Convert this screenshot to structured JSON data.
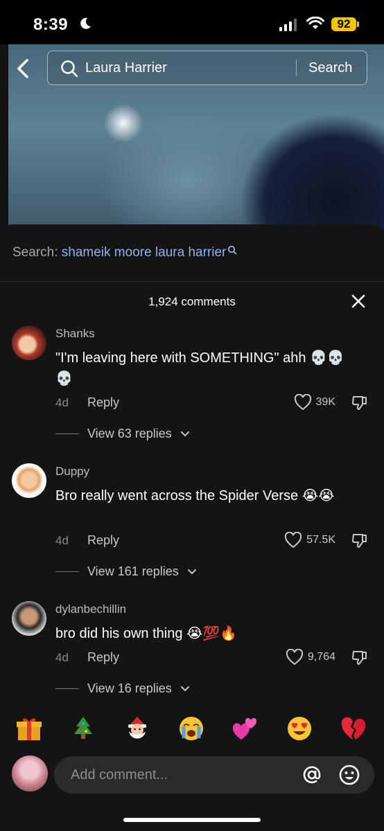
{
  "status_bar": {
    "time": "8:39",
    "battery": "92",
    "battery_color": "#f5c400"
  },
  "search_bar": {
    "query": "Laura Harrier",
    "button_label": "Search"
  },
  "search_suggestion": {
    "label": "Search:",
    "query": "shameik moore laura harrier"
  },
  "comments_panel": {
    "count_label": "1,924 comments"
  },
  "comments": [
    {
      "username": "Shanks",
      "text": "\"I'm leaving here with SOMETHING\" ahh 💀💀💀",
      "age": "4d",
      "reply_label": "Reply",
      "likes": "39K",
      "view_replies": "View 63 replies"
    },
    {
      "username": "Duppy",
      "text": "Bro really went across the Spider Verse 😭😭",
      "age": "4d",
      "reply_label": "Reply",
      "likes": "57.5K",
      "view_replies": "View 161 replies"
    },
    {
      "username": "dylanbechillin",
      "text": "bro did his own thing 😭💯🔥",
      "age": "4d",
      "reply_label": "Reply",
      "likes": "9,764",
      "view_replies": "View 16 replies"
    }
  ],
  "quick_emojis": [
    "🎁",
    "🎄",
    "🎅",
    "😭",
    "💕",
    "😍",
    "💔"
  ],
  "comment_input": {
    "placeholder": "Add comment..."
  },
  "colors": {
    "accent_link": "#8fb3ea",
    "sheet_bg": "#141414",
    "input_bg": "#2a2a2a"
  }
}
